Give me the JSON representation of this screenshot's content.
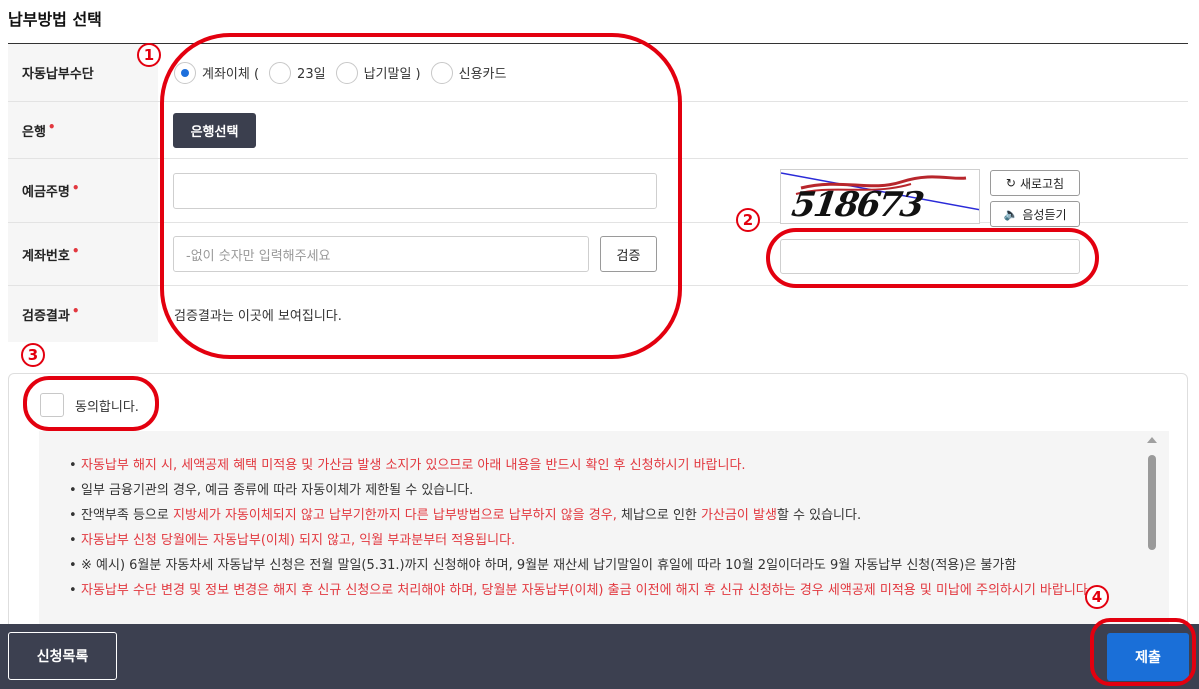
{
  "page": {
    "title": "납부방법 선택"
  },
  "form": {
    "payment_method": {
      "label": "자동납부수단",
      "options": [
        {
          "label": "계좌이체 (",
          "selected": true
        },
        {
          "label": "23일",
          "selected": false
        },
        {
          "label": "납기말일 )",
          "selected": false
        },
        {
          "label": "신용카드",
          "selected": false
        }
      ]
    },
    "bank": {
      "label": "은행",
      "required_mark": "•",
      "button_label": "은행선택"
    },
    "depositor": {
      "label": "예금주명",
      "required_mark": "•",
      "value": ""
    },
    "account": {
      "label": "계좌번호",
      "required_mark": "•",
      "placeholder": "-없이 숫자만 입력해주세요",
      "verify_button": "검증"
    },
    "result": {
      "label": "검증결과",
      "required_mark": "•",
      "text": "검증결과는 이곳에 보여집니다."
    }
  },
  "captcha": {
    "text": "518673",
    "refresh_label": "새로고침",
    "audio_label": "음성듣기",
    "input_value": ""
  },
  "agreement": {
    "checkbox_label": "동의합니다.",
    "checked": false,
    "notices": [
      {
        "style": "red",
        "parts": [
          {
            "t": "자동납부 해지 시, 세액공제 혜택 미적용 및 가산금 발생 소지가 있으므로 아래 내용을 반드시 확인 후 신청하시기 바랍니다.",
            "h": false
          }
        ]
      },
      {
        "style": "normal",
        "parts": [
          {
            "t": "일부 금융기관의 경우, 예금 종류에 따라 자동이체가 제한될 수 있습니다.",
            "h": false
          }
        ]
      },
      {
        "style": "normal",
        "parts": [
          {
            "t": "잔액부족 등으로 ",
            "h": false
          },
          {
            "t": "지방세가 자동이체되지 않고 납부기한까지 다른 납부방법으로 납부하지 않을 경우,",
            "h": true
          },
          {
            "t": " 체납으로 인한 ",
            "h": false
          },
          {
            "t": "가산금이 발생",
            "h": true
          },
          {
            "t": "할 수 있습니다.",
            "h": false
          }
        ]
      },
      {
        "style": "red",
        "parts": [
          {
            "t": "자동납부 신청 당월에는 자동납부(이체) 되지 않고, 익월 부과분부터 적용됩니다.",
            "h": false
          }
        ]
      },
      {
        "style": "normal",
        "parts": [
          {
            "t": "※ 예시) 6월분 자동차세 자동납부 신청은 전월 말일(5.31.)까지 신청해야 하며, 9월분 재산세 납기말일이 휴일에 따라 10월 2일이더라도 9월 자동납부 신청(적용)은 불가함",
            "h": false
          }
        ]
      },
      {
        "style": "red",
        "parts": [
          {
            "t": "자동납부 수단 변경 및 정보 변경은 해지 후 신규 신청으로 처리해야 하며, 당월분 자동납부(이체) 출금 이전에 해지 후 신규 신청하는 경우 세액공제 미적용 및 미납에 주의하시기 바랍니다.",
            "h": false
          }
        ]
      }
    ]
  },
  "footer": {
    "list_button": "신청목록",
    "submit_button": "제출"
  },
  "annotations": [
    "1",
    "2",
    "3",
    "4"
  ],
  "colors": {
    "accent": "#1a6fd8",
    "annotation": "#e3000f",
    "required": "#e2383f",
    "dark_button": "#3b3f4e",
    "bottom_bar": "#3c4050"
  }
}
